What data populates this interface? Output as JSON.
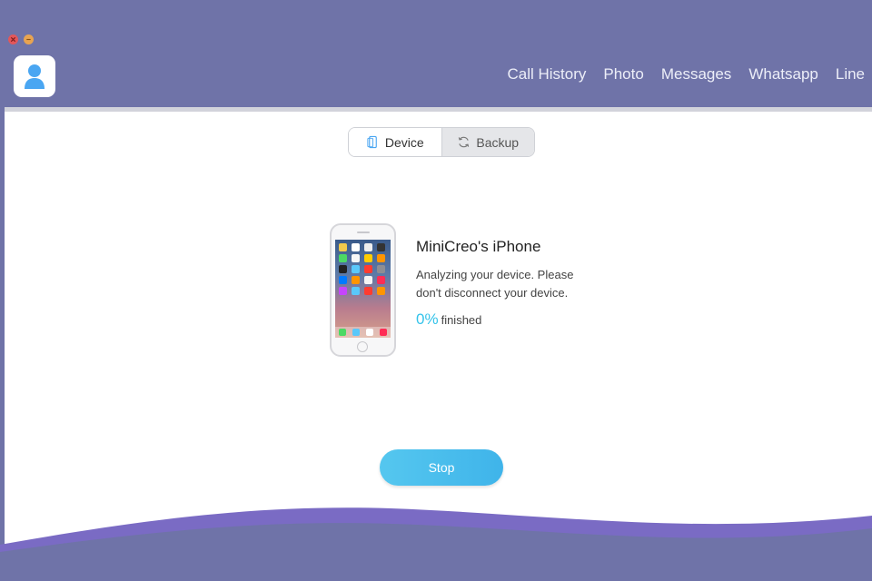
{
  "window": {
    "controls": [
      {
        "name": "close",
        "color": "#e2575a"
      },
      {
        "name": "minimize",
        "color": "#e8a451"
      }
    ]
  },
  "app": {
    "logo_icon": "user-icon",
    "accent": "#4aa6f2"
  },
  "nav": {
    "items": [
      {
        "label": "Call History"
      },
      {
        "label": "Photo"
      },
      {
        "label": "Messages"
      },
      {
        "label": "Whatsapp"
      },
      {
        "label": "Line"
      }
    ]
  },
  "mode_toggle": {
    "device_label": "Device",
    "backup_label": "Backup",
    "selected": "Device"
  },
  "device": {
    "name": "MiniCreo's iPhone",
    "status_line1": "Analyzing your device. Please",
    "status_line2": "don't disconnect your device.",
    "progress_value": "0%",
    "progress_suffix": "finished",
    "progress_color": "#34c3ea"
  },
  "actions": {
    "stop_label": "Stop"
  },
  "colors": {
    "background": "#6f73a8",
    "wave": "#7a6bc4",
    "stop_button": "#4bbcec"
  }
}
